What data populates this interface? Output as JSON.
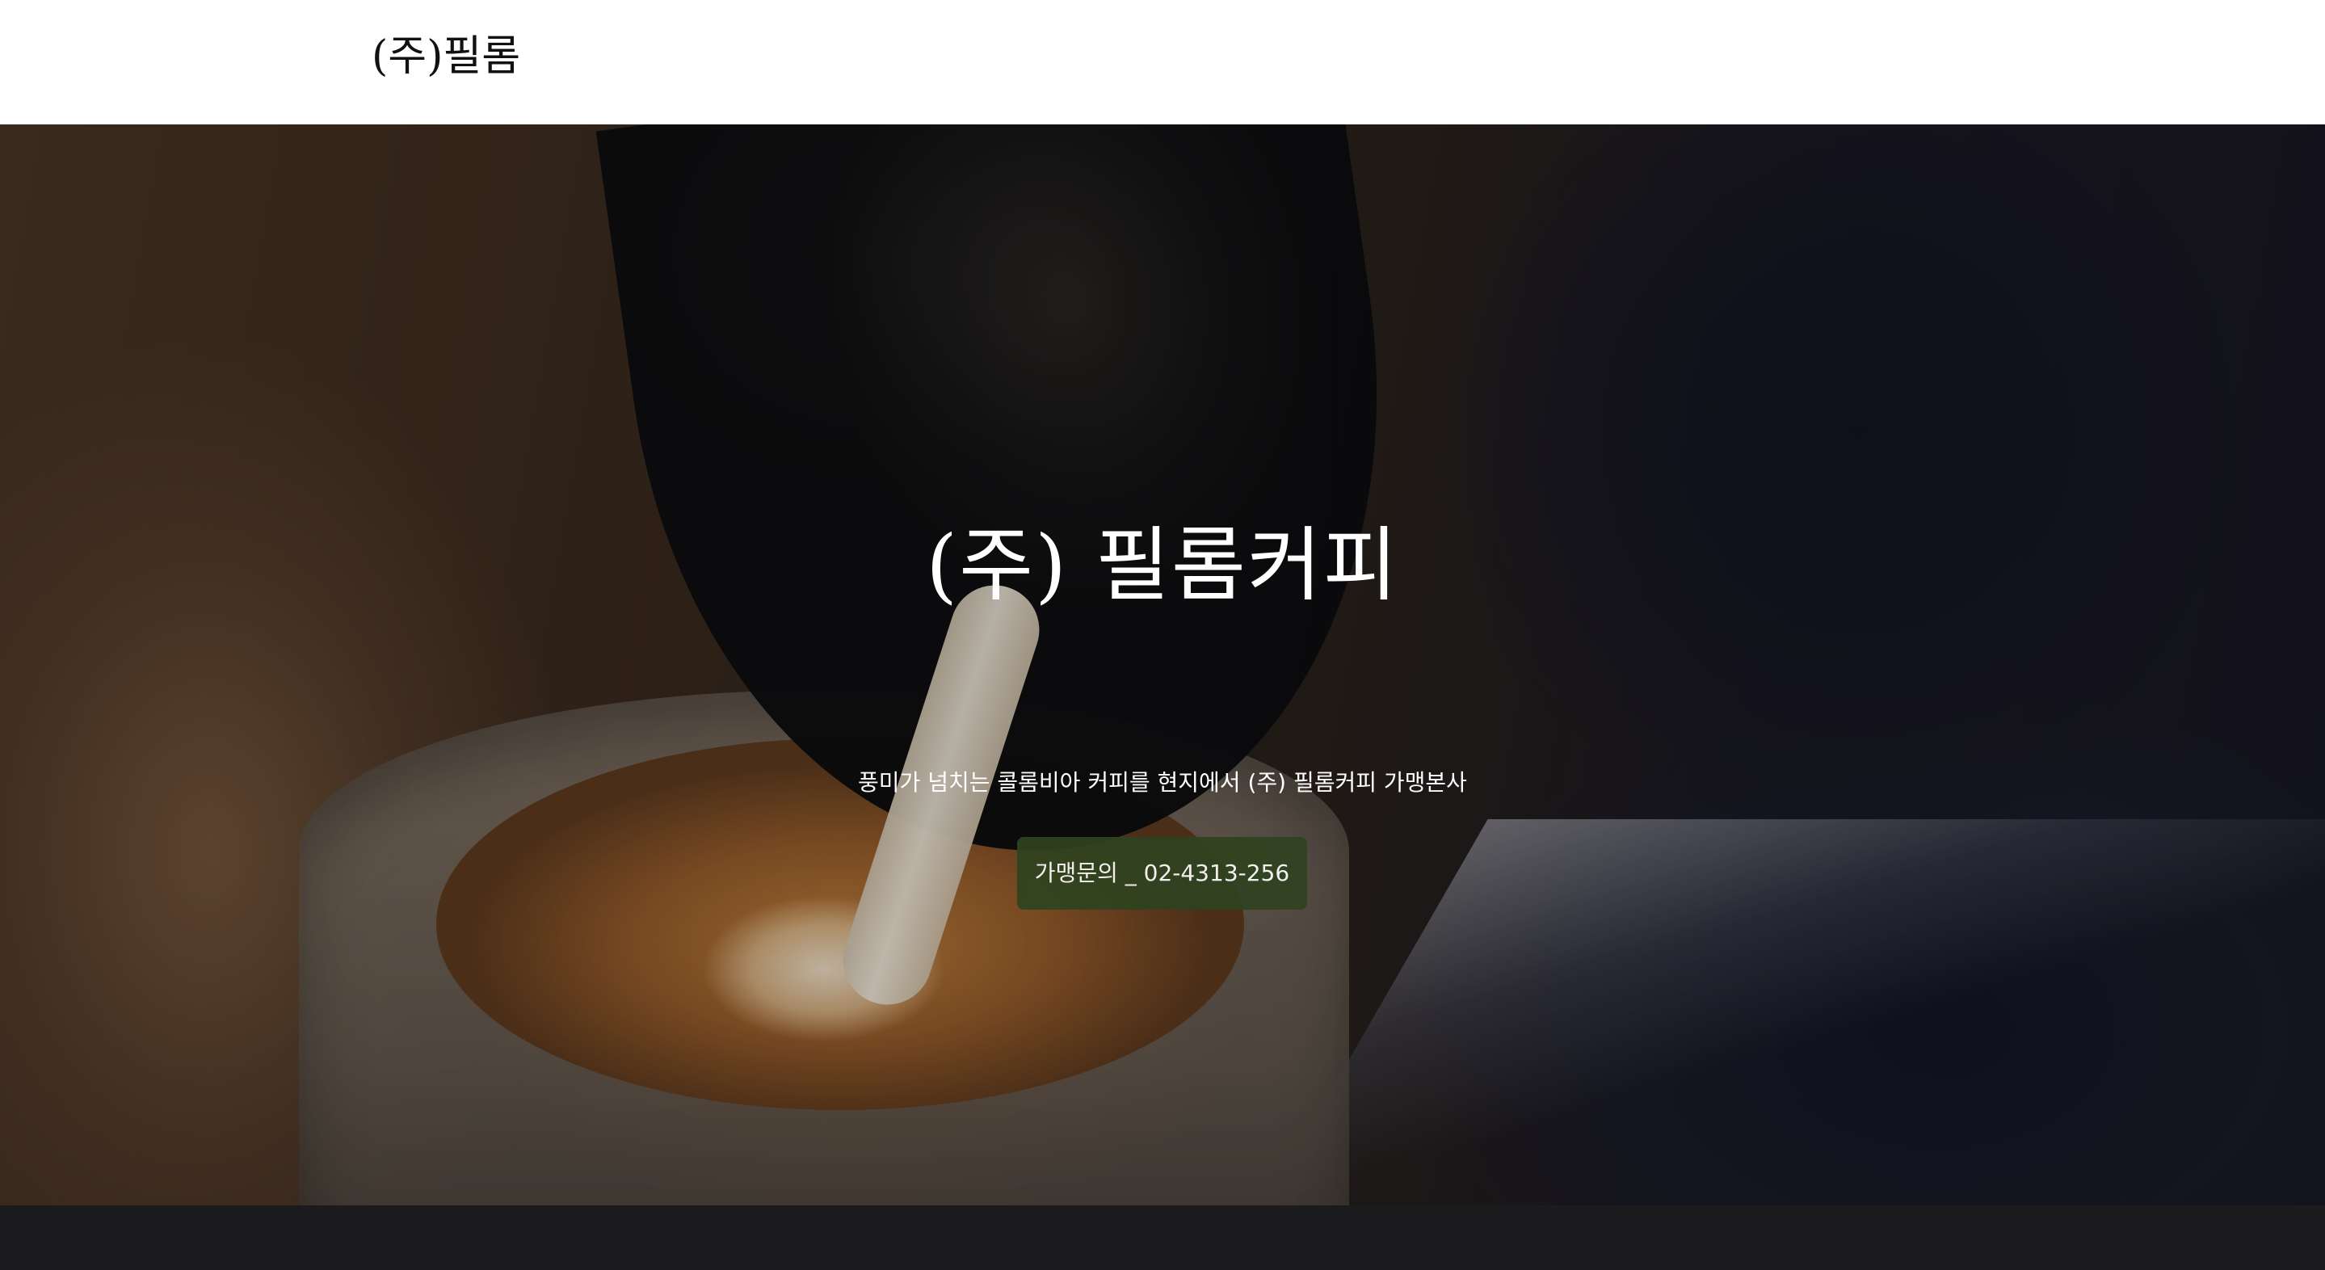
{
  "header": {
    "brand": "(주)필롬"
  },
  "hero": {
    "title": "(주) 필롬커피",
    "subtitle": "풍미가 넘치는 콜롬비아 커피를 현지에서 (주) 필롬커피 가맹본사",
    "cta_label": "가맹문의 _ 02-4313-256"
  },
  "colors": {
    "cta_background": "#2f4320",
    "footer_background": "#1b1b1d"
  }
}
